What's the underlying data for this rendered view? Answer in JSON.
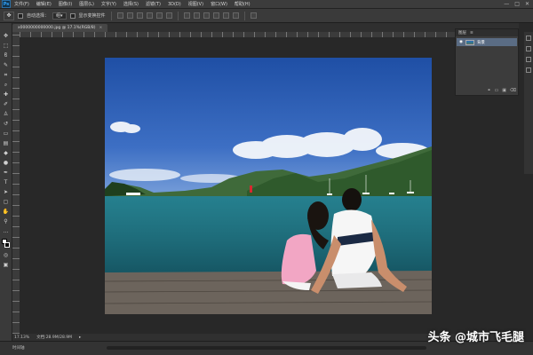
{
  "menubar": {
    "logo": "Ps",
    "items": [
      "文件(F)",
      "编辑(E)",
      "图像(I)",
      "图层(L)",
      "文字(Y)",
      "选择(S)",
      "滤镜(T)",
      "3D(D)",
      "视图(V)",
      "窗口(W)",
      "帮助(H)"
    ],
    "window_controls": [
      "—",
      "□",
      "✕"
    ]
  },
  "options": {
    "auto_select_label": "自动选择：",
    "auto_select_value": "组",
    "show_transform_label": "显示变换控件"
  },
  "document_tab": {
    "title": "x0000000000000.jpg @ 17.1%(RGB/8)",
    "close": "×"
  },
  "layers_panel": {
    "tab_label": "图层",
    "layer_name": "背景"
  },
  "statusbar": {
    "zoom": "17.13%",
    "doc_size": "文档:28.9M/28.9M"
  },
  "timeline": {
    "label": "时间轴"
  },
  "watermark": {
    "text": "头条 @城市飞毛腿"
  },
  "colors": {
    "foreground": "#ffffff",
    "background": "#000000",
    "workspace": "#282828"
  }
}
